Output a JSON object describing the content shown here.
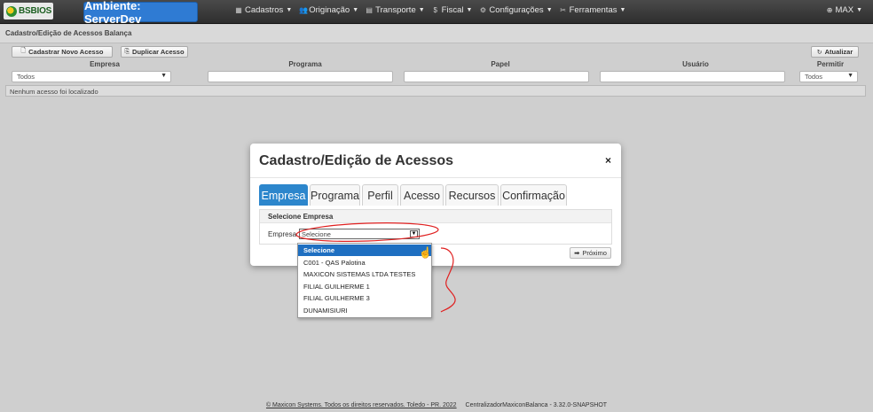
{
  "navbar": {
    "logo_text": "BSBIOS",
    "environment": "Ambiente: ServerDev",
    "menus": [
      {
        "label": "Cadastros",
        "icon": "grid-icon"
      },
      {
        "label": "Originação",
        "icon": "people-icon"
      },
      {
        "label": "Transporte",
        "icon": "calendar-icon"
      },
      {
        "label": "Fiscal",
        "icon": "dollar-icon"
      },
      {
        "label": "Configurações",
        "icon": "gear-icon"
      },
      {
        "label": "Ferramentas",
        "icon": "tools-icon"
      }
    ],
    "user": "MAX"
  },
  "page": {
    "title": "Cadastro/Edição de Acessos Balança",
    "buttons": {
      "new": "Cadastrar Novo Acesso",
      "duplicate": "Duplicar Acesso",
      "refresh": "Atualizar"
    },
    "columns": [
      "Empresa",
      "Programa",
      "Papel",
      "Usuário",
      "Permitir"
    ],
    "filters": {
      "empresa": "Todos",
      "programa": "",
      "papel": "",
      "usuario": "",
      "permitir": "Todos"
    },
    "empty_message": "Nenhum acesso foi localizado"
  },
  "modal": {
    "title": "Cadastro/Edição de Acessos",
    "close": "×",
    "tabs": [
      "Empresa",
      "Programa",
      "Perfil",
      "Acesso",
      "Recursos",
      "Confirmação"
    ],
    "active_tab": "Empresa",
    "panel_title": "Selecione Empresa",
    "field_label": "Empresa",
    "select_value": "Selecione",
    "next_button": "Próximo"
  },
  "dropdown": {
    "options": [
      "Selecione",
      "C001 - QAS Palotina",
      "MAXICON SISTEMAS LTDA TESTES",
      "FILIAL GUILHERME 1",
      "FILIAL GUILHERME 3",
      "DUNAMISIURI"
    ],
    "selected_index": 0
  },
  "footer": {
    "copyright": "© Maxicon Systems. Todos os direitos reservados. Toledo - PR. 2022",
    "version": "CentralizadorMaxiconBalanca - 3.32.0-SNAPSHOT"
  },
  "colors": {
    "navbar": "#3a3a3a",
    "environment_badge": "#2f7bd3",
    "active_tab": "#2c86cc",
    "dropdown_selected": "#1e6fc1",
    "annotation": "#e02020"
  }
}
